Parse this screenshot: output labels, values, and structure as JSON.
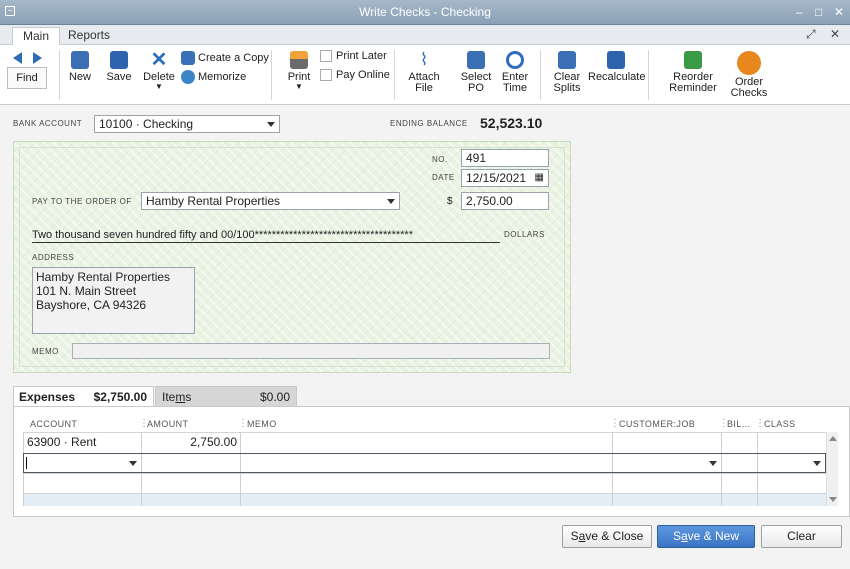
{
  "window": {
    "title": "Write Checks - Checking"
  },
  "tabs": [
    {
      "label": "Main"
    },
    {
      "label": "Reports"
    }
  ],
  "toolbar": {
    "find": "Find",
    "new": "New",
    "save": "Save",
    "delete": "Delete",
    "create_copy": "Create a Copy",
    "memorize": "Memorize",
    "print": "Print",
    "print_later": "Print Later",
    "pay_online": "Pay Online",
    "attach_file_1": "Attach",
    "attach_file_2": "File",
    "select_po_1": "Select",
    "select_po_2": "PO",
    "enter_time_1": "Enter",
    "enter_time_2": "Time",
    "clear_splits_1": "Clear",
    "clear_splits_2": "Splits",
    "recalculate": "Recalculate",
    "reorder_reminder_1": "Reorder",
    "reorder_reminder_2": "Reminder",
    "order_checks_1": "Order",
    "order_checks_2": "Checks"
  },
  "form": {
    "bank_account_label": "BANK ACCOUNT",
    "bank_account": "10100 · Checking",
    "ending_balance_label": "ENDING BALANCE",
    "ending_balance": "52,523.10",
    "no_label": "NO.",
    "check_no": "491",
    "date_label": "DATE",
    "date": "12/15/2021",
    "payee_label": "PAY TO THE ORDER OF",
    "payee": "Hamby Rental Properties",
    "dollar_sign": "$",
    "amount": "2,750.00",
    "amount_words": "Two thousand seven hundred fifty and 00/100*************************************",
    "dollars_label": "DOLLARS",
    "address_label": "ADDRESS",
    "address_lines": [
      "Hamby Rental Properties",
      "101 N. Main Street",
      "Bayshore, CA 94326"
    ],
    "memo_label": "MEMO"
  },
  "splits": {
    "expenses_label": "Expenses",
    "expenses_total": "$2,750.00",
    "items_label_pre": "Ite",
    "items_label_u": "m",
    "items_label_post": "s",
    "items_total": "$0.00",
    "columns": [
      "ACCOUNT",
      "AMOUNT",
      "MEMO",
      "CUSTOMER:JOB",
      "BIL...",
      "CLASS"
    ],
    "rows": [
      {
        "account": "63900 · Rent",
        "amount": "2,750.00"
      }
    ]
  },
  "buttons": {
    "save_close_pre": "S",
    "save_close_u": "a",
    "save_close_post": "ve & Close",
    "save_new_pre": "S",
    "save_new_u": "a",
    "save_new_post": "ve & New",
    "clear": "Clear"
  },
  "colors": {
    "primary_button": "#3b74c4",
    "check_bg": "#eaf3e3",
    "titlebar": "#8aa1b5"
  }
}
